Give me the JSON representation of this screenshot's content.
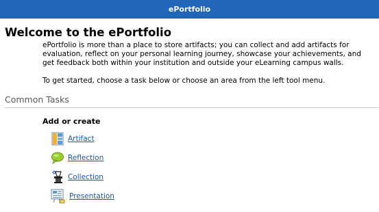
{
  "window": {
    "title": "ePortfolio"
  },
  "welcome": {
    "heading": "Welcome to the ePortfolio"
  },
  "intro": {
    "lines": [
      "ePortfolio is more than a place to store artifacts; you can collect and add artifacts for",
      "evaluation, reflect on your personal learning journey, showcase your achievements, and",
      "get feedback both within your institution and outside your eLearning campus walls."
    ],
    "get_started": "To get started, choose a task below or choose an area from the left tool menu."
  },
  "common_tasks": {
    "heading": "Common Tasks",
    "add_or_create": "Add or create",
    "items": [
      {
        "label": "Artifact",
        "icon": "artifact-icon"
      },
      {
        "label": "Reflection",
        "icon": "reflection-icon"
      },
      {
        "label": "Collection",
        "icon": "collection-icon"
      },
      {
        "label": "Presentation",
        "icon": "presentation-icon"
      }
    ]
  },
  "colors": {
    "titlebar": "#2166b8",
    "link": "#1c57a6"
  }
}
